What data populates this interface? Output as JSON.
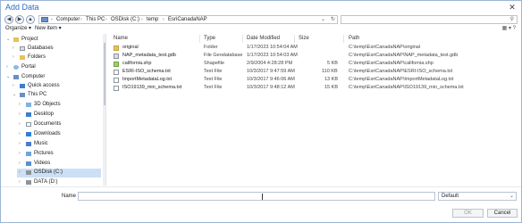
{
  "window": {
    "title": "Add Data",
    "close": "✕"
  },
  "nav": {
    "back": "◀",
    "forward": "▶",
    "up": "▲"
  },
  "address": {
    "crumbs": [
      "Computer",
      "This PC",
      "OSDisk (C:)",
      "temp",
      "EsriCanadaNAP"
    ],
    "sep": "›",
    "dropdown": "⌄",
    "refresh": "↻"
  },
  "search": {
    "placeholder": "",
    "icon": "⚲"
  },
  "toolbar": {
    "organize": "Organize ▾",
    "new_item": "New item ▾",
    "view": "▦ ▾  ?"
  },
  "tree": [
    {
      "label": "Project",
      "arrow": "⌄"
    },
    {
      "label": "Databases",
      "arrow": "›"
    },
    {
      "label": "Folders",
      "arrow": "›"
    },
    {
      "label": "Portal",
      "arrow": "›"
    },
    {
      "label": "Computer",
      "arrow": "⌄"
    },
    {
      "label": "Quick access",
      "arrow": "›"
    },
    {
      "label": "This PC",
      "arrow": "⌄"
    },
    {
      "label": "3D Objects",
      "arrow": "›"
    },
    {
      "label": "Desktop",
      "arrow": "›"
    },
    {
      "label": "Documents",
      "arrow": "›"
    },
    {
      "label": "Downloads",
      "arrow": "›"
    },
    {
      "label": "Music",
      "arrow": "›"
    },
    {
      "label": "Pictures",
      "arrow": "›"
    },
    {
      "label": "Videos",
      "arrow": "›"
    },
    {
      "label": "OSDisk (C:)",
      "arrow": "›"
    },
    {
      "label": "DATA (D:)",
      "arrow": "›"
    }
  ],
  "columns": {
    "name": "Name",
    "type": "Type",
    "date": "Date Modified",
    "size": "Size",
    "path": "Path"
  },
  "files": [
    {
      "name": "original",
      "type": "Folder",
      "date": "1/17/2023 10:54:04 AM",
      "size": "",
      "path": "C:\\temp\\EsriCanadaNAP\\original"
    },
    {
      "name": "NAP_metadata_test.gdb",
      "type": "File Geodatabase",
      "date": "1/17/2023 10:54:03 AM",
      "size": "",
      "path": "C:\\temp\\EsriCanadaNAP\\NAP_metadata_test.gdb"
    },
    {
      "name": "california.shp",
      "type": "Shapefile",
      "date": "2/9/2004 4:28:28 PM",
      "size": "5 KB",
      "path": "C:\\temp\\EsriCanadaNAP\\california.shp"
    },
    {
      "name": "ESRI-ISO_schema.txt",
      "type": "Text File",
      "date": "10/3/2017 9:47:59 AM",
      "size": "110 KB",
      "path": "C:\\temp\\EsriCanadaNAP\\ESRI-ISO_schema.txt"
    },
    {
      "name": "ImportMetadataLog.txt",
      "type": "Text File",
      "date": "10/3/2017 9:46:06 AM",
      "size": "13 KB",
      "path": "C:\\temp\\EsriCanadaNAP\\ImportMetadataLog.txt"
    },
    {
      "name": "ISO19139_min_schema.txt",
      "type": "Text File",
      "date": "10/3/2017 9:48:12 AM",
      "size": "15 KB",
      "path": "C:\\temp\\EsriCanadaNAP\\ISO19139_min_schema.txt"
    }
  ],
  "bottom": {
    "name_label": "Name",
    "name_value": "",
    "filter_value": "Default",
    "filter_dd": "⌄",
    "ok": "OK",
    "cancel": "Cancel"
  },
  "colors": {
    "title": "#2b6cc4",
    "selected": "#cce0f5",
    "folder": "#e8c15a"
  }
}
